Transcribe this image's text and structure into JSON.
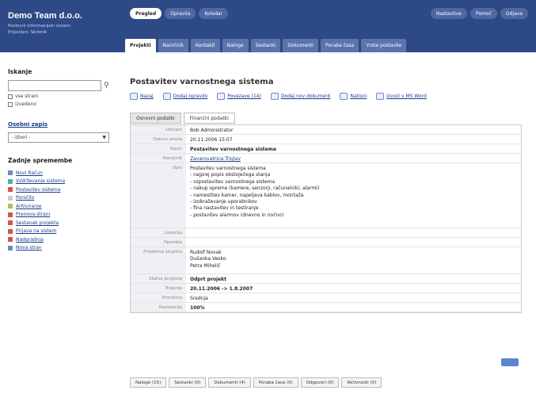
{
  "brand": {
    "title": "Demo Team d.o.o.",
    "subtitle_1": "Poslovni informacijski sistem",
    "subtitle_2": "Prijavljen: Skrbnik"
  },
  "top_buttons_left": [
    {
      "label": "Pregled",
      "active": true
    },
    {
      "label": "Opravila",
      "active": false
    },
    {
      "label": "Koledar",
      "active": false
    }
  ],
  "top_buttons_right": [
    {
      "label": "Nastavitve"
    },
    {
      "label": "Pomoč"
    },
    {
      "label": "Odjava"
    }
  ],
  "nav_tabs": [
    {
      "label": "Projekti",
      "active": true
    },
    {
      "label": "Naročnik",
      "active": false
    },
    {
      "label": "Kontakti",
      "active": false
    },
    {
      "label": "Naloge",
      "active": false
    },
    {
      "label": "Sestanki",
      "active": false
    },
    {
      "label": "Dokumenti",
      "active": false
    },
    {
      "label": "Poraba časa",
      "active": false
    },
    {
      "label": "Vrste postavke",
      "active": false
    }
  ],
  "sidebar": {
    "search_heading": "Iskanje",
    "check_1": "vse strani",
    "check_2": "izvedeno",
    "quick_link": "Osebni zapis",
    "select_value": "- izberi -",
    "list_heading": "Zadnje spremembe",
    "items": [
      {
        "label": "Novi Račun",
        "color": "#6b8cc9"
      },
      {
        "label": "Vzdrževanje sistema",
        "color": "#4ab3a0"
      },
      {
        "label": "Postavitev sistema",
        "color": "#d9534f"
      },
      {
        "label": "Poročilo",
        "color": "#cccccc"
      },
      {
        "label": "Arhiviranje",
        "color": "#a7c06a"
      },
      {
        "label": "Prenova strani",
        "color": "#d9534f"
      },
      {
        "label": "Sestanek projekta",
        "color": "#d9534f"
      },
      {
        "label": "Prijava na sistem",
        "color": "#d9534f"
      },
      {
        "label": "Nadgradnja",
        "color": "#d9534f"
      },
      {
        "label": "Nova stran",
        "color": "#6b8cc9"
      }
    ]
  },
  "page_title": "Postavitev varnostnega sistema",
  "actions": [
    "Nazaj",
    "Dodaj opravilo",
    "Povezave (14)",
    "Dodaj nov dokument",
    "Natisni",
    "Izvozi v MS Word"
  ],
  "sub_tabs": [
    {
      "label": "Osnovni podatki",
      "active": true
    },
    {
      "label": "Finančni podatki",
      "active": false
    }
  ],
  "details": [
    {
      "label": "Ustvaril",
      "value": "Bob Administrator",
      "style": "normal"
    },
    {
      "label": "Datum vnosa",
      "value": "20.11.2006 15:07",
      "style": "normal"
    },
    {
      "label": "Naziv",
      "value": "Postavitev varnostnega sistema",
      "style": "bold"
    },
    {
      "label": "Naročnik",
      "value": "Zavarovalnica Triglav",
      "style": "link"
    },
    {
      "label": "Opis",
      "value": "Postavitev varnostnega sistema\n- najprej popis obstoječega stanja\n- vzpostavitev varnostnega sistema\n- nakup opreme (kamere, senzorji, računalniki, alarmi)\n- namestitev kamer, napeljava kablov, montaža\n- izobraževanje uporabnikov\n- fina nastavitev in testiranje\n- postavitev alarmov (dnevno in nočno)",
      "style": "multiline"
    },
    {
      "label": "Lokacija",
      "value": "",
      "style": "normal"
    },
    {
      "label": "Opomba",
      "value": "",
      "style": "normal"
    },
    {
      "label": "Projektna skupina",
      "value": "Rudolf Novak\nDušanka Vesko\nPetra Mihelič",
      "style": "multiline"
    },
    {
      "label": "Status projekta",
      "value": "Odprt projekt",
      "style": "bold"
    },
    {
      "label": "Trajanje",
      "value": "20.11.2006  ->  1.8.2007",
      "style": "bold"
    },
    {
      "label": "Prioriteta",
      "value": "Srednja",
      "style": "normal"
    },
    {
      "label": "Realizacija",
      "value": "100%",
      "style": "bold"
    }
  ],
  "bottom_tabs": [
    "Naloge (15)",
    "Sestanki (0)",
    "Dokumenti (4)",
    "Poraba časa (0)",
    "Odgovori (0)",
    "Aktivnosti (0)"
  ]
}
